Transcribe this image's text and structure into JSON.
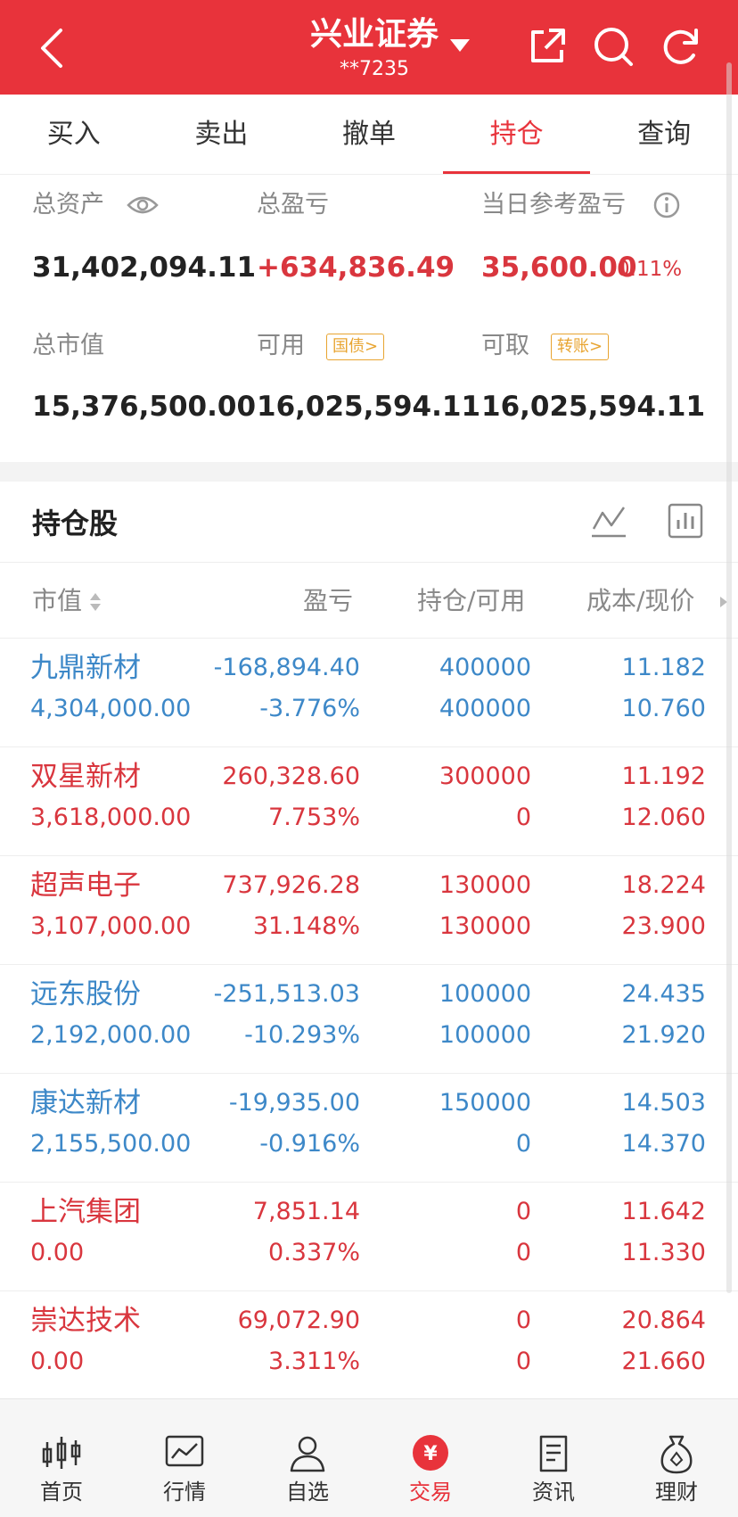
{
  "header": {
    "title": "兴业证券",
    "account": "**7235",
    "icons": [
      "back-icon",
      "share-icon",
      "search-icon",
      "refresh-icon"
    ],
    "brand_color": "#e8333b"
  },
  "tabs": [
    {
      "label": "买入",
      "active": false
    },
    {
      "label": "卖出",
      "active": false
    },
    {
      "label": "撤单",
      "active": false
    },
    {
      "label": "持仓",
      "active": true
    },
    {
      "label": "查询",
      "active": false
    }
  ],
  "summary": {
    "total_assets_label": "总资产",
    "total_assets": "31,402,094.11",
    "total_pl_label": "总盈亏",
    "total_pl": "+634,836.49",
    "daily_pl_label": "当日参考盈亏",
    "daily_pl": "35,600.00",
    "daily_pl_pct": "0.11%",
    "market_value_label": "总市值",
    "market_value": "15,376,500.00",
    "available_label": "可用",
    "available_tag": "国债>",
    "available": "16,025,594.11",
    "withdrawable_label": "可取",
    "withdrawable_tag": "转账>",
    "withdrawable": "16,025,594.11"
  },
  "holdings": {
    "title": "持仓股",
    "columns": {
      "market_value": "市值",
      "pl": "盈亏",
      "position": "持仓/可用",
      "cost": "成本/现价"
    },
    "rows": [
      {
        "name": "九鼎新材",
        "market_value": "4,304,000.00",
        "pl": "-168,894.40",
        "pl_pct": "-3.776%",
        "position": "400000",
        "available": "400000",
        "cost": "11.182",
        "price": "10.760",
        "color": "blue"
      },
      {
        "name": "双星新材",
        "market_value": "3,618,000.00",
        "pl": "260,328.60",
        "pl_pct": "7.753%",
        "position": "300000",
        "available": "0",
        "cost": "11.192",
        "price": "12.060",
        "color": "red"
      },
      {
        "name": "超声电子",
        "market_value": "3,107,000.00",
        "pl": "737,926.28",
        "pl_pct": "31.148%",
        "position": "130000",
        "available": "130000",
        "cost": "18.224",
        "price": "23.900",
        "color": "red"
      },
      {
        "name": "远东股份",
        "market_value": "2,192,000.00",
        "pl": "-251,513.03",
        "pl_pct": "-10.293%",
        "position": "100000",
        "available": "100000",
        "cost": "24.435",
        "price": "21.920",
        "color": "blue"
      },
      {
        "name": "康达新材",
        "market_value": "2,155,500.00",
        "pl": "-19,935.00",
        "pl_pct": "-0.916%",
        "position": "150000",
        "available": "0",
        "cost": "14.503",
        "price": "14.370",
        "color": "blue"
      },
      {
        "name": "上汽集团",
        "market_value": "0.00",
        "pl": "7,851.14",
        "pl_pct": "0.337%",
        "position": "0",
        "available": "0",
        "cost": "11.642",
        "price": "11.330",
        "color": "red"
      },
      {
        "name": "崇达技术",
        "market_value": "0.00",
        "pl": "69,072.90",
        "pl_pct": "3.311%",
        "position": "0",
        "available": "0",
        "cost": "20.864",
        "price": "21.660",
        "color": "red"
      }
    ]
  },
  "bottom_nav": [
    {
      "label": "首页",
      "icon": "candlestick-icon",
      "active": false
    },
    {
      "label": "行情",
      "icon": "chart-icon",
      "active": false
    },
    {
      "label": "自选",
      "icon": "user-icon",
      "active": false
    },
    {
      "label": "交易",
      "icon": "yuan-icon",
      "active": true
    },
    {
      "label": "资讯",
      "icon": "news-icon",
      "active": false
    },
    {
      "label": "理财",
      "icon": "money-bag-icon",
      "active": false
    }
  ]
}
